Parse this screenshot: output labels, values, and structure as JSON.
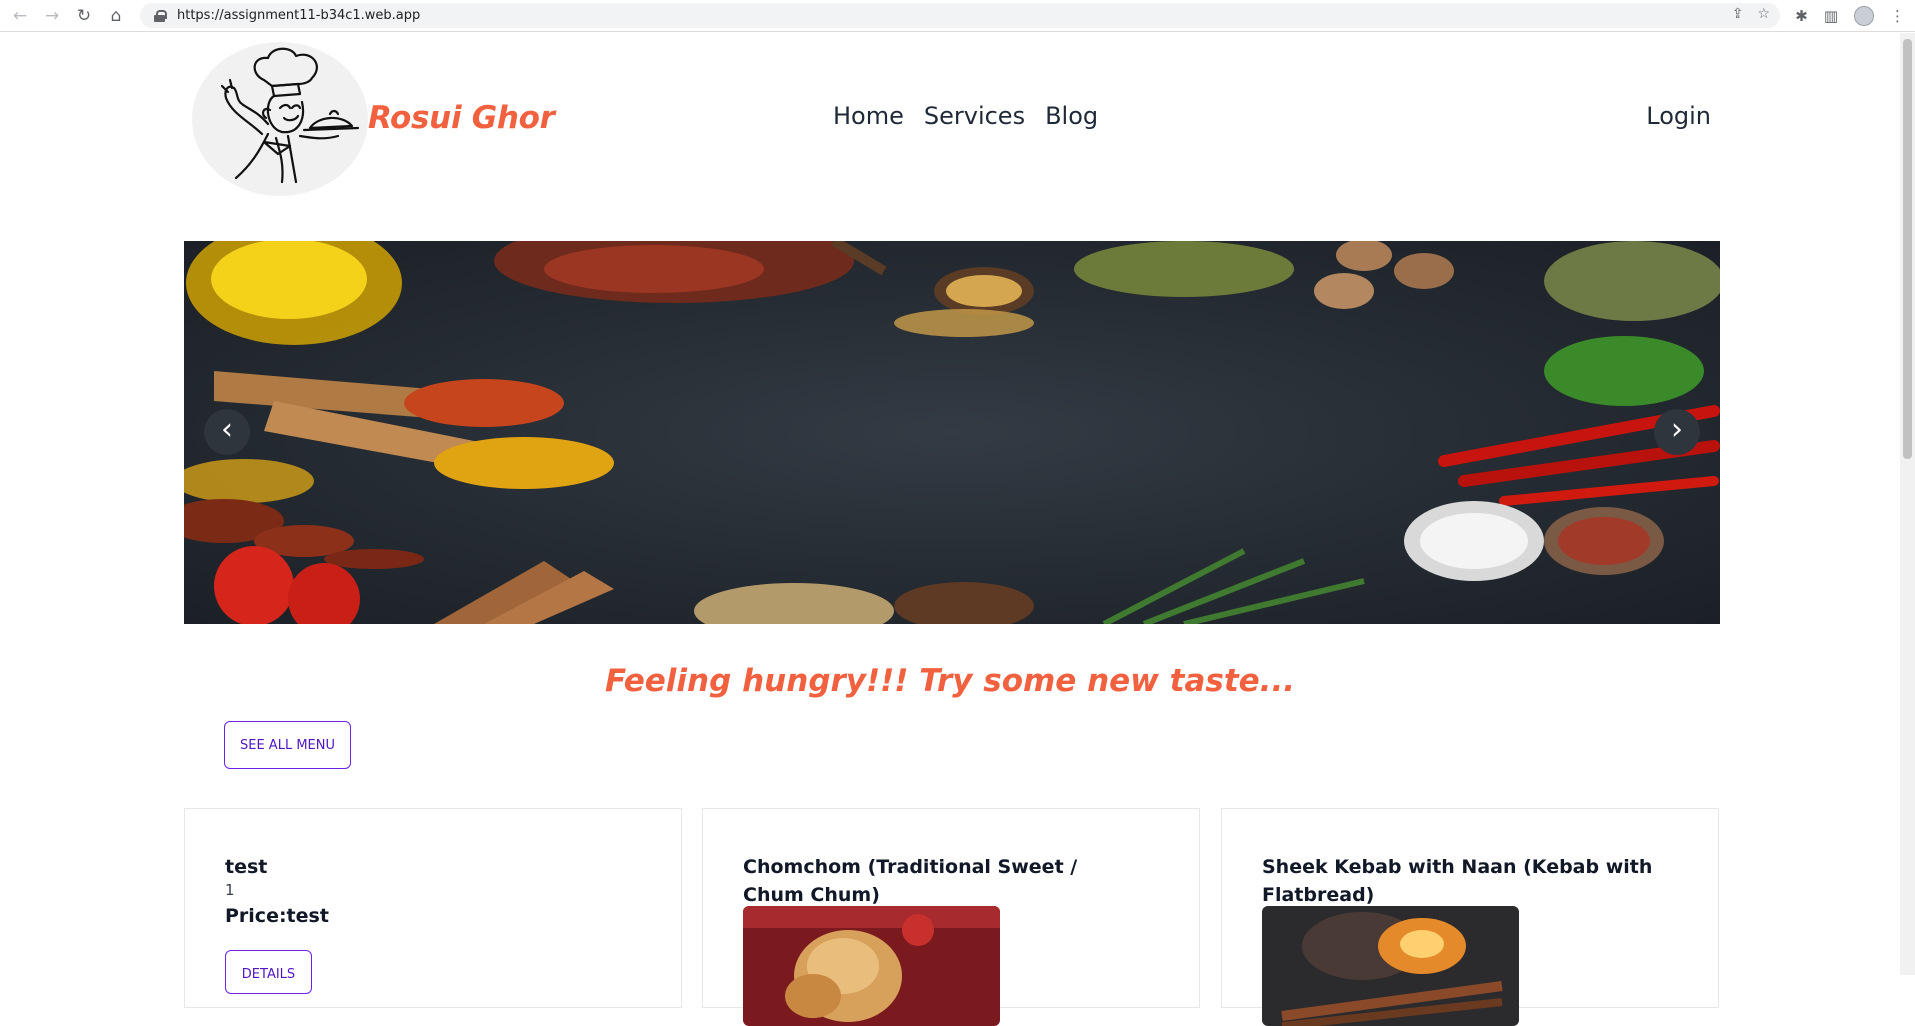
{
  "browser": {
    "url": "https://assignment11-b34c1.web.app"
  },
  "header": {
    "brand": "Rosui Ghor",
    "nav": [
      "Home",
      "Services",
      "Blog"
    ],
    "login": "Login"
  },
  "carousel": {
    "prev_label": "‹",
    "next_label": "›"
  },
  "tagline": "Feeling hungry!!! Try some new taste...",
  "see_all_menu": "SEE ALL MENU",
  "cards": [
    {
      "title": "test",
      "description": "1",
      "price": "Price:test",
      "button": "DETAILS"
    },
    {
      "title": "Chomchom (Traditional Sweet / Chum Chum)"
    },
    {
      "title": "Sheek Kebab with Naan (Kebab with Flatbread)"
    }
  ],
  "colors": {
    "accent": "#f2613f",
    "button_border": "#6b21e8"
  }
}
